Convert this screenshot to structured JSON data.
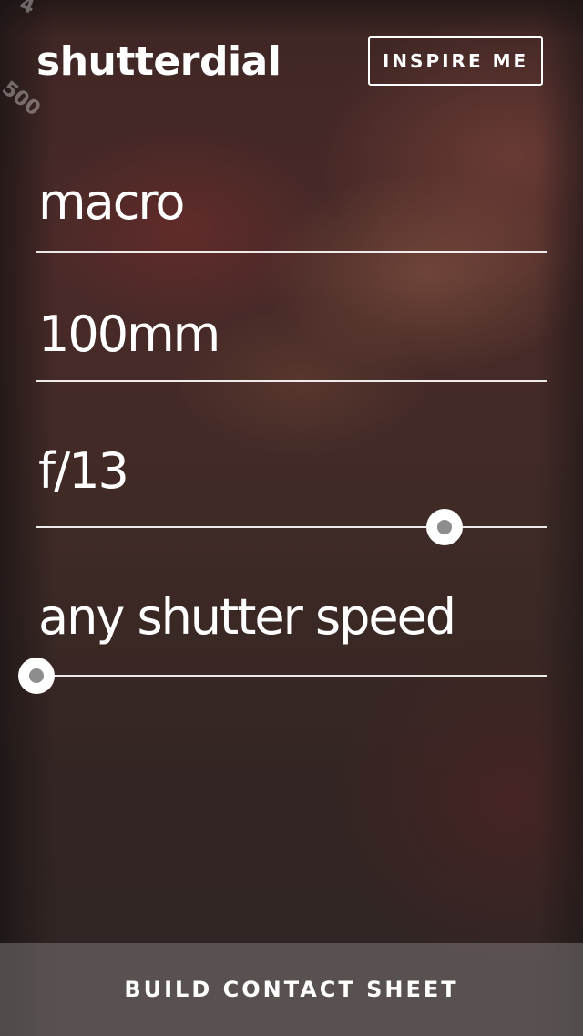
{
  "app": {
    "logo": "shutterdial",
    "dial_marks": [
      "4",
      "500"
    ]
  },
  "header": {
    "inspire_label": "INSPIRE ME"
  },
  "fields": {
    "scene": {
      "value": "macro"
    },
    "focal_length": {
      "value": "100mm"
    },
    "aperture": {
      "value": "f/13",
      "slider_position": 0.8
    },
    "shutter": {
      "value": "any shutter speed",
      "slider_position": 0.0
    }
  },
  "footer": {
    "build_label": "BUILD CONTACT SHEET"
  },
  "colors": {
    "text": "#ffffff",
    "thumb": "#ffffff",
    "thumb_center": "#8d8d8d"
  }
}
